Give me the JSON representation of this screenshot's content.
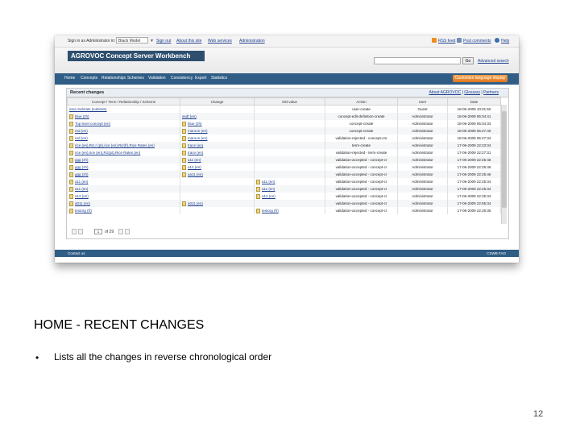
{
  "screenshot": {
    "topbar": {
      "signed_in_label": "Sign in as Administrator in:",
      "model_value": "Black Model",
      "sign_out": "Sign out",
      "about_site": "About this site",
      "web_services": "Web services",
      "administration": "Administration",
      "rss_feed": "RSS feed",
      "post_comments": "Post comments",
      "help": "Help"
    },
    "app_title": "AGROVOC Concept Server Workbench",
    "search": {
      "placeholder": "",
      "go_label": "Go",
      "advanced_label": "Advanced search"
    },
    "menu": [
      "Home",
      "Concepts",
      "Relationships",
      "Schemes",
      "Validation",
      "Consistency",
      "Export",
      "Statistics"
    ],
    "language_button": "Customize language display",
    "panel": {
      "title": "Recent changes",
      "links": [
        "About AGROVOC",
        "Glossary",
        "Partners"
      ],
      "columns": [
        "Concept / Term / Relationship / Scheme",
        "Change",
        "Old value",
        "Action",
        "User",
        "Date"
      ],
      "rows": [
        {
          "concept": "irma Subirats (subirats)",
          "change": "",
          "old": "",
          "action": "user-create",
          "user": "Guest",
          "date": "18-06-2009 10:01:50",
          "ci": false,
          "chi": false,
          "oi": false
        },
        {
          "concept": "blue (zh)",
          "change": "asdf (en)",
          "old": "",
          "action": "concept-edit-definition-create",
          "user": "Administrator",
          "date": "18-06-2009 06:04:41",
          "ci": true,
          "chi": false,
          "oi": false
        },
        {
          "concept": "Top level concept (en)",
          "change": "blue (zh)",
          "old": "",
          "action": "concept-create",
          "user": "Administrator",
          "date": "18-06-2009 06:04:33",
          "ci": true,
          "chi": true,
          "oi": false
        },
        {
          "concept": "red (en)",
          "change": "maroon (en)",
          "old": "",
          "action": "concept-create",
          "user": "Administrator",
          "date": "18-06-2009 06:47:40",
          "ci": true,
          "chi": true,
          "oi": false
        },
        {
          "concept": "red (en)",
          "change": "maroon (en)",
          "old": "",
          "action": "validation-rejected - concept-cre",
          "user": "Administrator",
          "date": "18-06-2009 06:47:34",
          "ci": true,
          "chi": true,
          "oi": false
        },
        {
          "concept": "rice (en),Riz,r (pt),rice (en),Riz(fr),Rice Rates (en)",
          "change": "trace (en)",
          "old": "",
          "action": "term-create",
          "user": "Administrator",
          "date": "17-06-2009 22:23:34",
          "ci": true,
          "chi": true,
          "oi": false
        },
        {
          "concept": "rice (en),rice (en),Riz(pt),Rice Rates (en)",
          "change": "trace (en)",
          "old": "",
          "action": "validation-rejected - term-create",
          "user": "Administrator",
          "date": "17-06-2009 22:27:31",
          "ci": true,
          "chi": true,
          "oi": false
        },
        {
          "concept": "ggg (zh)",
          "change": "a11 (en)",
          "old": "",
          "action": "validation-accepted - concept-cr",
          "user": "Administrator",
          "date": "17-06-2009 22:25:46",
          "ci": true,
          "chi": true,
          "oi": false
        },
        {
          "concept": "ggg (zh)",
          "change": "a12 (en)",
          "old": "",
          "action": "validation-accepted - concept-cr",
          "user": "Administrator",
          "date": "17-06-2009 22:25:46",
          "ci": true,
          "chi": true,
          "oi": false
        },
        {
          "concept": "ggg (zh)",
          "change": "aa11 (en)",
          "old": "",
          "action": "validation-accepted - concept-cr",
          "user": "Administrator",
          "date": "17-06-2009 22:25:46",
          "ci": true,
          "chi": true,
          "oi": false
        },
        {
          "concept": "a11 (en)",
          "change": "",
          "old": "a11 (en)",
          "action": "validation-accepted - concept-cr",
          "user": "Administrator",
          "date": "17-06-2009 22:25:34",
          "ci": true,
          "chi": false,
          "oi": true
        },
        {
          "concept": "a11 (en)",
          "change": "",
          "old": "a11 (en)",
          "action": "validation-accepted - concept-cr",
          "user": "Administrator",
          "date": "17-06-2009 22:25:34",
          "ci": true,
          "chi": false,
          "oi": true
        },
        {
          "concept": "a12 (en)",
          "change": "",
          "old": "a12 (en)",
          "action": "validation-accepted - concept-cr",
          "user": "Administrator",
          "date": "17-06-2009 22:25:34",
          "ci": true,
          "chi": false,
          "oi": true
        },
        {
          "concept": "a011 (en)",
          "change": "a011 (en)",
          "old": "",
          "action": "validation-accepted - concept-cr",
          "user": "Administrator",
          "date": "17-06-2009 22:55:34",
          "ci": true,
          "chi": true,
          "oi": false
        },
        {
          "concept": "testorg (fr)",
          "change": "",
          "old": "testorg (fr)",
          "action": "validation-accepted - concept-cr",
          "user": "Administrator",
          "date": "17-06-2009 22:26:36",
          "ci": true,
          "chi": false,
          "oi": true
        }
      ]
    },
    "pager": {
      "page": "1",
      "of_label": "of 29"
    },
    "footer": {
      "left": "Contact us",
      "right": "CSWB FAO"
    }
  },
  "slide": {
    "title": "HOME - RECENT CHANGES",
    "bullet": "Lists all the changes in reverse chronological order",
    "bullet_symbol": "•",
    "page_number": "12"
  },
  "colors": {
    "menubar": "#2f5d86",
    "logo": "#2e4f6e",
    "accent_orange": "#de7820"
  }
}
